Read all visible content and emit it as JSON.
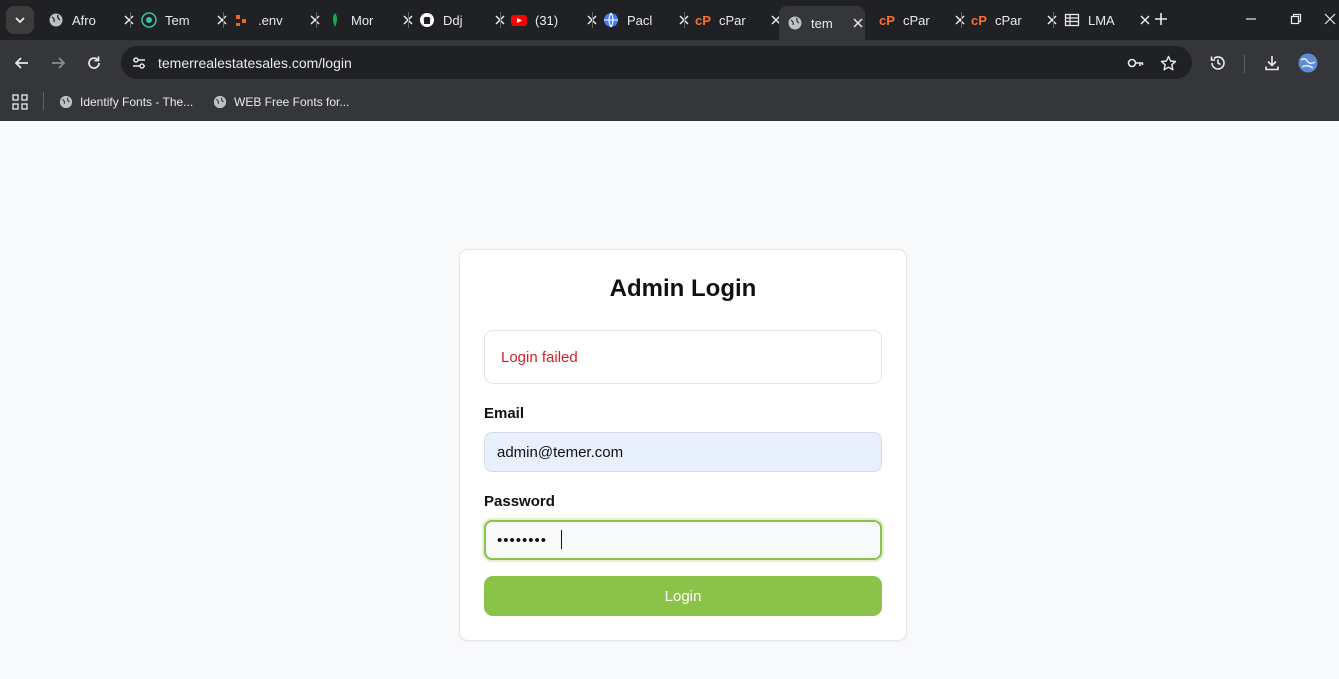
{
  "browser": {
    "tabs": [
      {
        "title": "Afro",
        "favicon": "globe-icon",
        "color": "#bdc1c6"
      },
      {
        "title": "Tem",
        "favicon": "temer-icon",
        "color": "#3cc0a8"
      },
      {
        "title": ".env",
        "favicon": "dots-icon",
        "color": "#f26522"
      },
      {
        "title": "Mor",
        "favicon": "mongodb-leaf-icon",
        "color": "#13aa52"
      },
      {
        "title": "Ddj",
        "favicon": "github-icon",
        "color": "#ffffff"
      },
      {
        "title": "(31)",
        "favicon": "youtube-icon",
        "color": "#ff0000"
      },
      {
        "title": "Pacl",
        "favicon": "web-icon",
        "color": "#4a7cf0"
      },
      {
        "title": "cPar",
        "favicon": "cpanel-icon",
        "color": "#ff6c2c"
      },
      {
        "title": "tem",
        "favicon": "globe-icon",
        "color": "#bdc1c6",
        "active": true
      },
      {
        "title": "cPar",
        "favicon": "cpanel-icon",
        "color": "#ff6c2c"
      },
      {
        "title": "cPar",
        "favicon": "cpanel-icon",
        "color": "#ff6c2c"
      },
      {
        "title": "LMA",
        "favicon": "spreadsheet-icon",
        "color": "#e8eaed"
      }
    ],
    "url": "temerrealestatesales.com/login",
    "bookmarks": [
      {
        "label": "Identify Fonts - The...",
        "icon": "globe-icon"
      },
      {
        "label": "WEB Free Fonts for...",
        "icon": "globe-icon"
      }
    ]
  },
  "login": {
    "title": "Admin Login",
    "error": "Login failed",
    "email_label": "Email",
    "email_value": "admin@temer.com",
    "password_label": "Password",
    "password_value": "••••••••",
    "button_label": "Login"
  },
  "colors": {
    "accent": "#8bc34a",
    "error": "#d11f26",
    "autofill": "#e8f0fe"
  }
}
